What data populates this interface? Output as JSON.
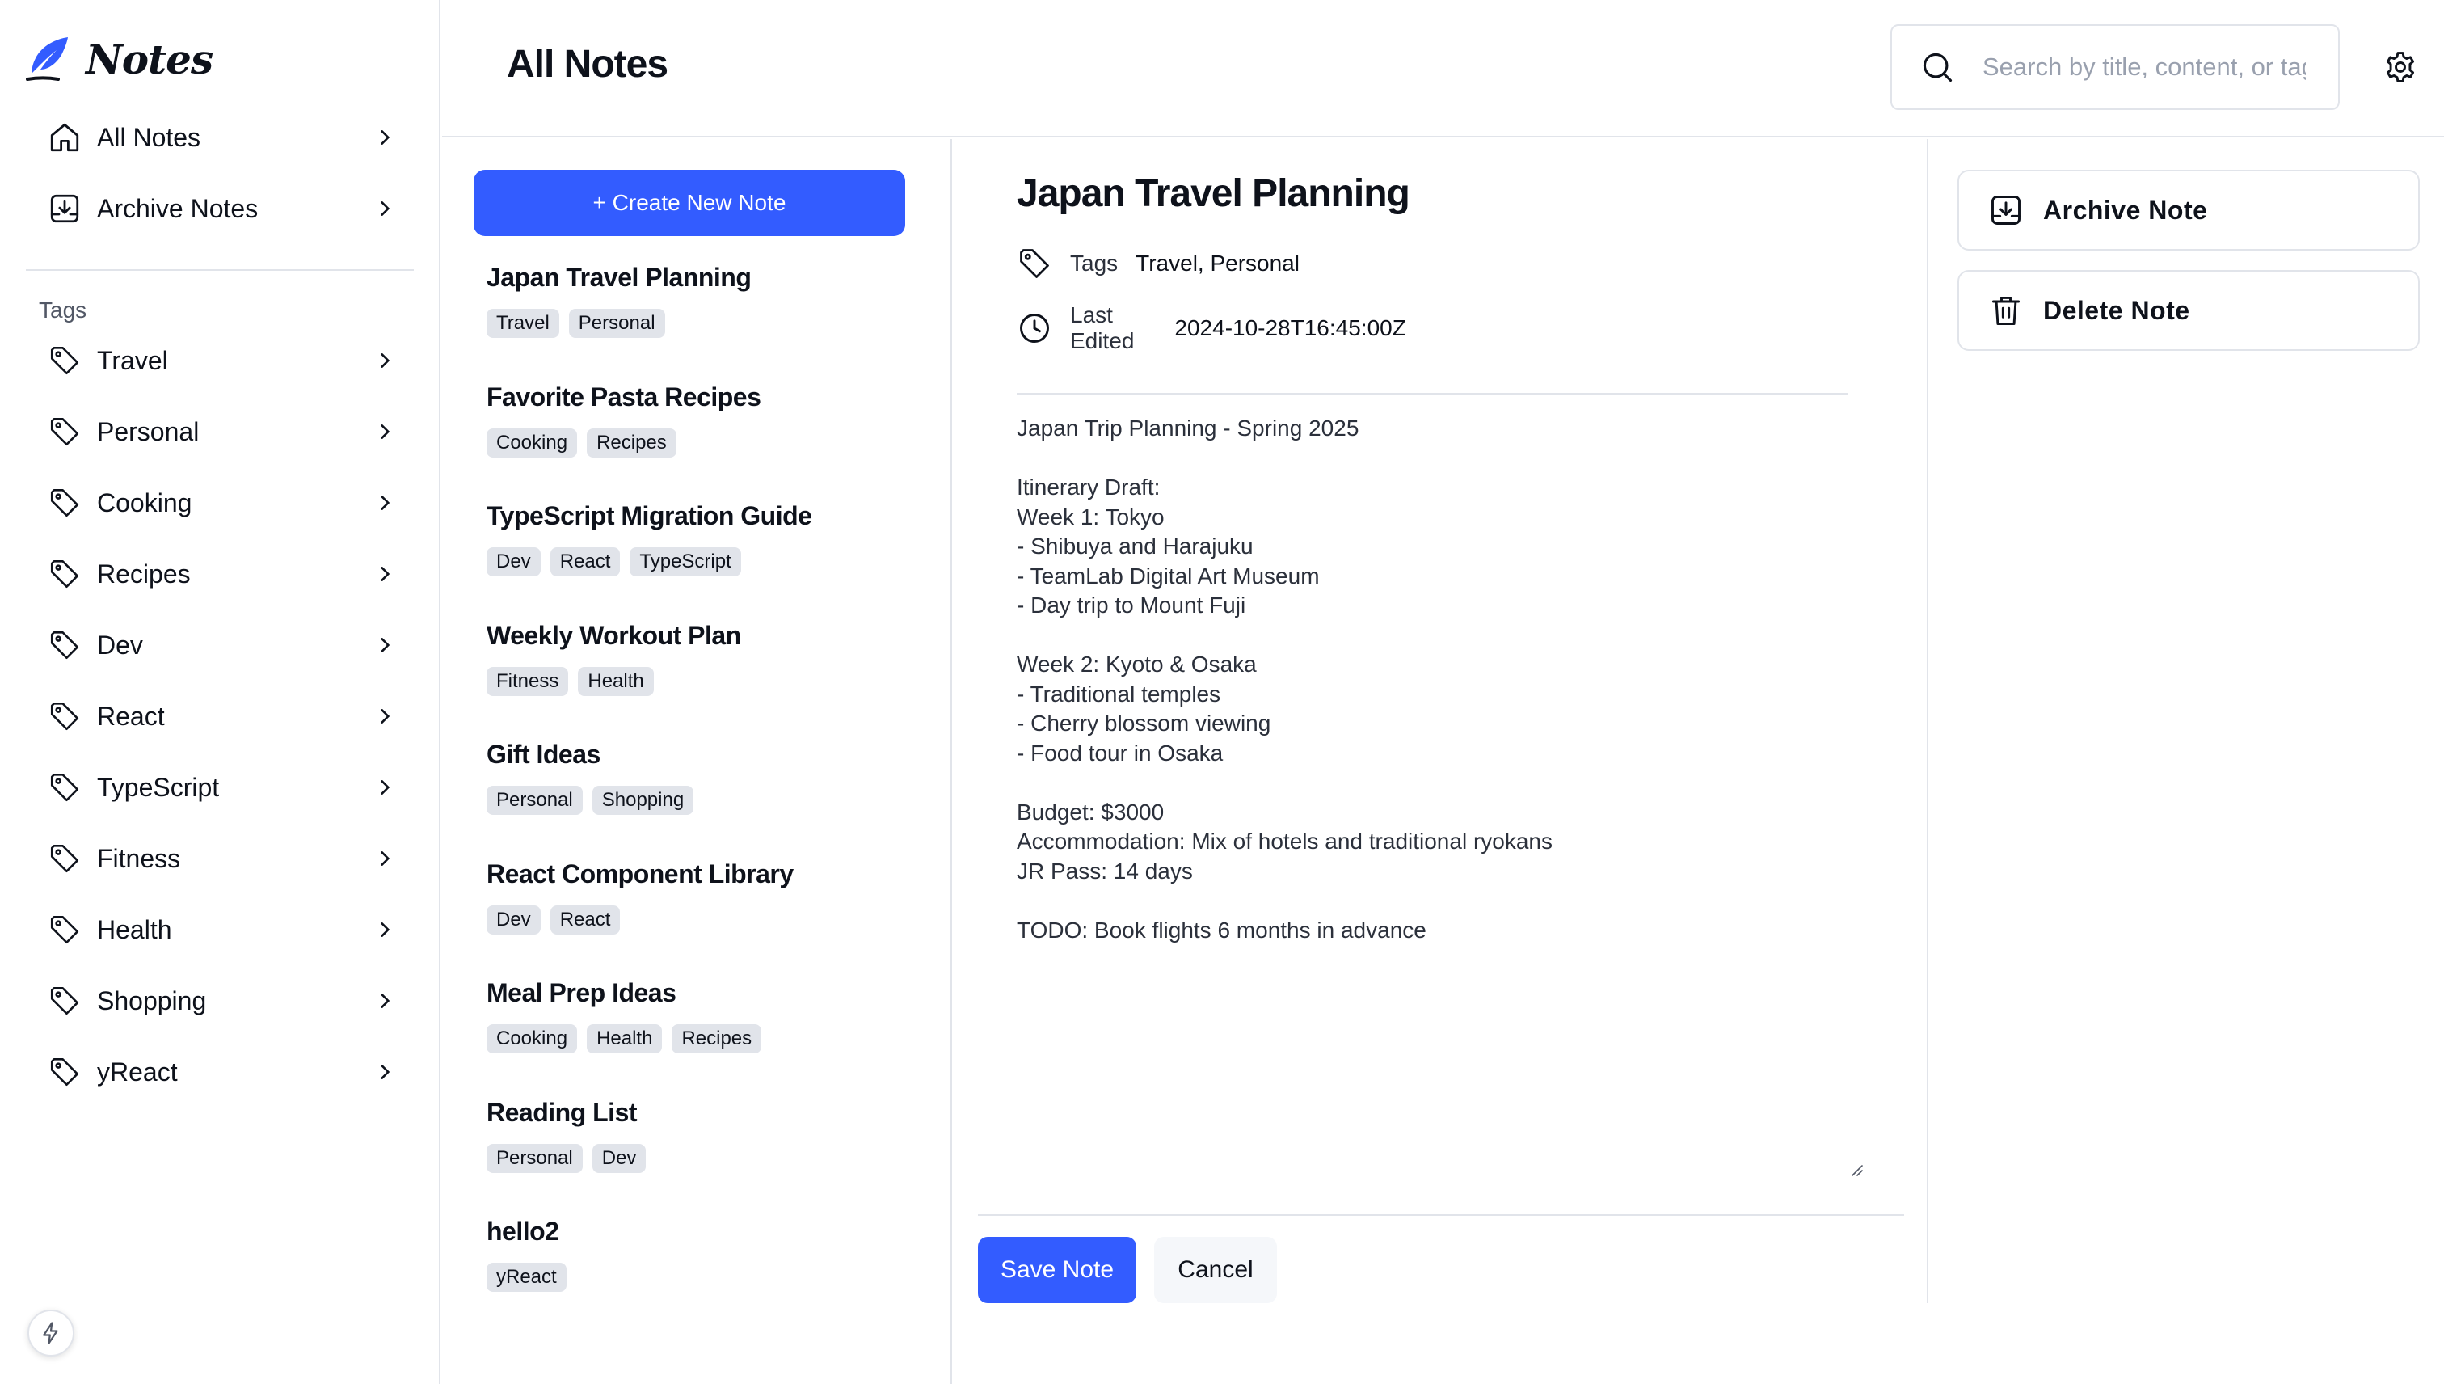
{
  "app": {
    "name": "Notes",
    "accent": "#335cff"
  },
  "sidebar": {
    "nav": [
      {
        "label": "All Notes",
        "icon": "home-icon"
      },
      {
        "label": "Archive Notes",
        "icon": "archive-icon"
      }
    ],
    "tags_heading": "Tags",
    "tags": [
      "Travel",
      "Personal",
      "Cooking",
      "Recipes",
      "Dev",
      "React",
      "TypeScript",
      "Fitness",
      "Health",
      "Shopping",
      "yReact"
    ]
  },
  "header": {
    "title": "All Notes",
    "search_placeholder": "Search by title, content, or tags..."
  },
  "list": {
    "create_label": "+ Create New Note",
    "notes": [
      {
        "title": "Japan Travel Planning",
        "tags": [
          "Travel",
          "Personal"
        ]
      },
      {
        "title": "Favorite Pasta Recipes",
        "tags": [
          "Cooking",
          "Recipes"
        ]
      },
      {
        "title": "TypeScript Migration Guide",
        "tags": [
          "Dev",
          "React",
          "TypeScript"
        ]
      },
      {
        "title": "Weekly Workout Plan",
        "tags": [
          "Fitness",
          "Health"
        ]
      },
      {
        "title": "Gift Ideas",
        "tags": [
          "Personal",
          "Shopping"
        ]
      },
      {
        "title": "React Component Library",
        "tags": [
          "Dev",
          "React"
        ]
      },
      {
        "title": "Meal Prep Ideas",
        "tags": [
          "Cooking",
          "Health",
          "Recipes"
        ]
      },
      {
        "title": "Reading List",
        "tags": [
          "Personal",
          "Dev"
        ]
      },
      {
        "title": "hello2",
        "tags": [
          "yReact"
        ]
      }
    ]
  },
  "editor": {
    "title": "Japan Travel Planning",
    "tags_label": "Tags",
    "tags_value": "Travel, Personal",
    "last_edited_label_1": "Last",
    "last_edited_label_2": "Edited",
    "last_edited_value": "2024-10-28T16:45:00Z",
    "content": "Japan Trip Planning - Spring 2025\n\nItinerary Draft:\nWeek 1: Tokyo\n- Shibuya and Harajuku\n- TeamLab Digital Art Museum\n- Day trip to Mount Fuji\n\nWeek 2: Kyoto & Osaka\n- Traditional temples\n- Cherry blossom viewing\n- Food tour in Osaka\n\nBudget: $3000\nAccommodation: Mix of hotels and traditional ryokans\nJR Pass: 14 days\n\nTODO: Book flights 6 months in advance",
    "save_label": "Save Note",
    "cancel_label": "Cancel"
  },
  "actions": {
    "archive_label": "Archive Note",
    "delete_label": "Delete Note"
  }
}
